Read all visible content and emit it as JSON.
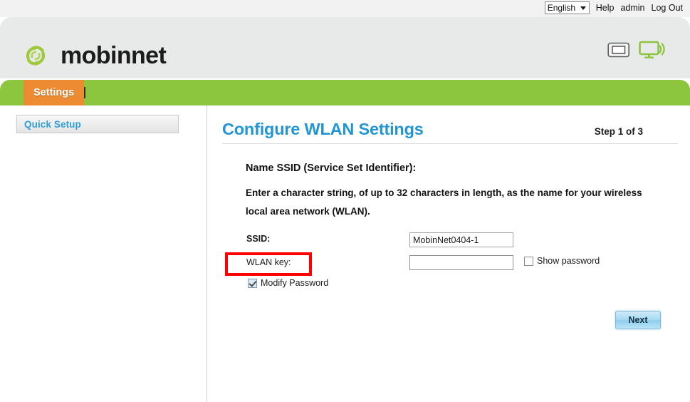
{
  "topbar": {
    "language": {
      "selected": "English",
      "options": [
        "English"
      ],
      "icon": "chevron-down-icon"
    },
    "links": [
      {
        "label": "Help"
      },
      {
        "label": "admin"
      },
      {
        "label": "Log Out"
      }
    ]
  },
  "header": {
    "brand": "mobinnet",
    "logo_color": "#9ec93a",
    "icons": [
      {
        "name": "sim-card-icon",
        "color": "#6b6b6b"
      },
      {
        "name": "wireless-display-icon",
        "color": "#8cc63e"
      }
    ],
    "background": "#e8eaea"
  },
  "nav": {
    "active_tab": "Settings",
    "tab_color": "#ed8b33",
    "bar_color": "#8cc63e"
  },
  "sidebar": {
    "items": [
      {
        "label": "Quick Setup",
        "color": "#2f9fd4"
      }
    ]
  },
  "main": {
    "title": "Configure WLAN Settings",
    "title_color": "#2296d3",
    "step": "Step 1 of 3",
    "section_heading": "Name SSID (Service Set Identifier):",
    "section_description": "Enter a character string, of up to 32 characters in length, as the name for your wireless local area network (WLAN).",
    "form": {
      "ssid": {
        "label": "SSID:",
        "value": "MobinNet0404-1",
        "placeholder": ""
      },
      "wlan_key": {
        "label": "WLAN key:",
        "value": "",
        "placeholder": "",
        "highlight_color": "#fe0000"
      },
      "show_password": {
        "label": "Show password",
        "checked": false
      },
      "modify_password": {
        "label": "Modify Password",
        "checked": true
      }
    },
    "next_button": "Next"
  }
}
